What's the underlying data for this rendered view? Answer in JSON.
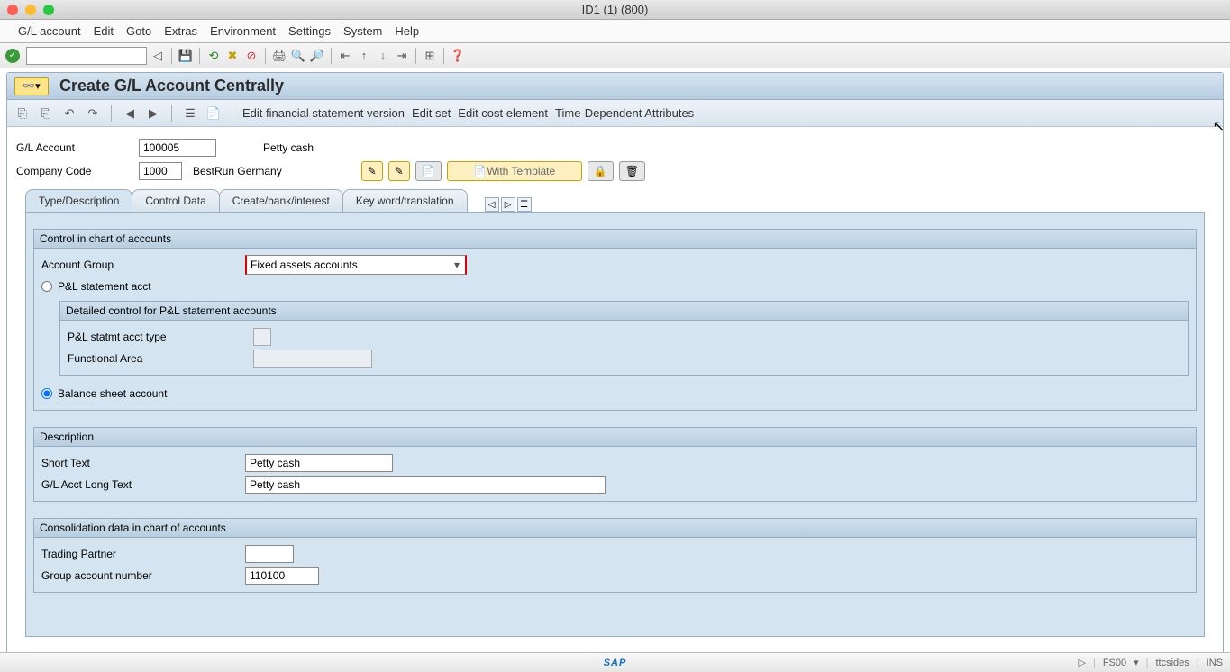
{
  "window": {
    "title": "ID1 (1) (800)"
  },
  "menu": [
    "G/L account",
    "Edit",
    "Goto",
    "Extras",
    "Environment",
    "Settings",
    "System",
    "Help"
  ],
  "page": {
    "title": "Create G/L Account Centrally",
    "toolbar_links": [
      "Edit financial statement version",
      "Edit set",
      "Edit cost element",
      "Time-Dependent Attributes"
    ]
  },
  "fields": {
    "gl_account_label": "G/L Account",
    "gl_account_value": "100005",
    "gl_account_desc": "Petty cash",
    "company_code_label": "Company Code",
    "company_code_value": "1000",
    "company_code_desc": "BestRun Germany",
    "with_template": "With Template"
  },
  "tabs": [
    "Type/Description",
    "Control Data",
    "Create/bank/interest",
    "Key word/translation"
  ],
  "group1": {
    "title": "Control in chart of accounts",
    "account_group_label": "Account Group",
    "account_group_value": "Fixed assets accounts",
    "pl_radio": "P&L statement acct",
    "sub_title": "Detailed control for P&L statement accounts",
    "pl_type_label": "P&L statmt acct type",
    "func_area_label": "Functional Area",
    "bs_radio": "Balance sheet account"
  },
  "group2": {
    "title": "Description",
    "short_label": "Short Text",
    "short_value": "Petty cash",
    "long_label": "G/L Acct Long Text",
    "long_value": "Petty cash"
  },
  "group3": {
    "title": "Consolidation data in chart of accounts",
    "trading_label": "Trading Partner",
    "group_acct_label": "Group account number",
    "group_acct_value": "110100"
  },
  "status": {
    "logo": "SAP",
    "tcode": "FS00",
    "user": "ttcsides",
    "mode": "INS"
  }
}
